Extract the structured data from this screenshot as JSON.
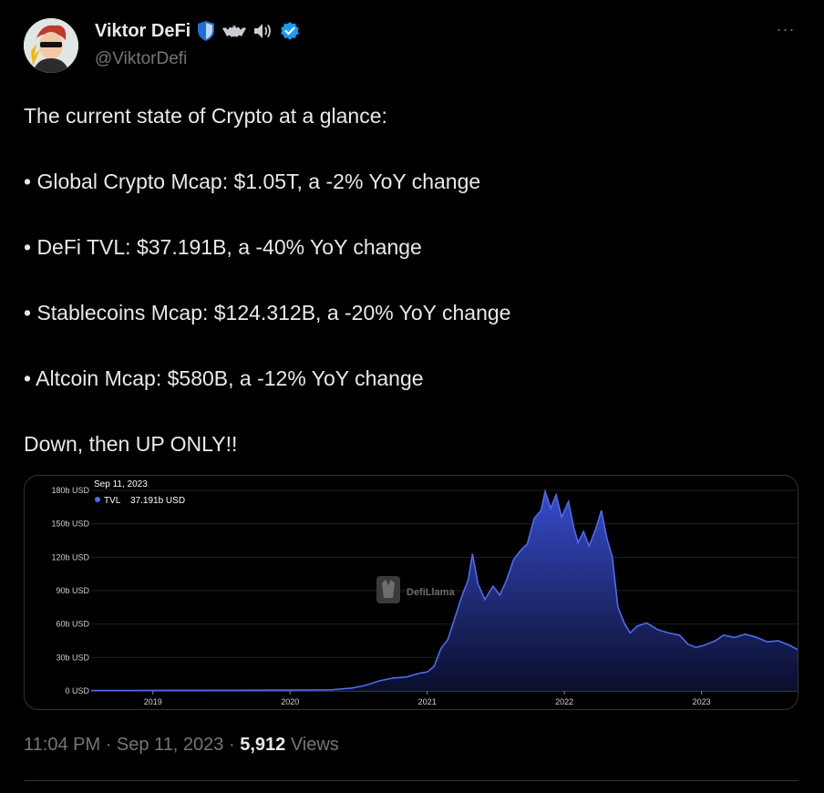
{
  "author": {
    "display_name": "Viktor DeFi",
    "handle": "@ViktorDefi",
    "badges": [
      "shield-icon",
      "bat-icon",
      "speaker-icon",
      "verified-icon"
    ],
    "verified_color": "#1d9bf0"
  },
  "tweet": {
    "intro": "The current state of Crypto at a glance:",
    "bullets": [
      "• Global Crypto Mcap: $1.05T, a -2% YoY change",
      "• DeFi TVL: $37.191B, a -40% YoY change",
      "• Stablecoins Mcap: $124.312B, a -20% YoY change",
      "• Altcoin Mcap: $580B, a -12% YoY change"
    ],
    "closing": "Down, then UP ONLY!!"
  },
  "chart_data": {
    "type": "area",
    "tooltip_date": "Sep 11, 2023",
    "tooltip_label": "TVL",
    "tooltip_value": "37.191b USD",
    "watermark": "DefiLlama",
    "yticks": [
      "0 USD",
      "30b USD",
      "60b USD",
      "90b USD",
      "120b USD",
      "150b USD",
      "180b USD"
    ],
    "xticks": [
      "2019",
      "2020",
      "2021",
      "2022",
      "2023"
    ],
    "ylim": [
      0,
      180
    ],
    "xlim": [
      2018.55,
      2023.7
    ],
    "line_color": "#4f6bed",
    "series": [
      {
        "values": [
          [
            2018.55,
            0.3
          ],
          [
            2019.0,
            0.5
          ],
          [
            2019.5,
            0.6
          ],
          [
            2020.0,
            0.7
          ],
          [
            2020.3,
            1.0
          ],
          [
            2020.45,
            2.5
          ],
          [
            2020.55,
            5.0
          ],
          [
            2020.65,
            9.0
          ],
          [
            2020.75,
            11.5
          ],
          [
            2020.85,
            12.5
          ],
          [
            2020.95,
            16.0
          ],
          [
            2021.0,
            17.0
          ],
          [
            2021.05,
            22.0
          ],
          [
            2021.1,
            38.0
          ],
          [
            2021.15,
            46.0
          ],
          [
            2021.2,
            65.0
          ],
          [
            2021.25,
            84.0
          ],
          [
            2021.3,
            100.0
          ],
          [
            2021.33,
            123.0
          ],
          [
            2021.37,
            96.0
          ],
          [
            2021.42,
            82.0
          ],
          [
            2021.48,
            94.0
          ],
          [
            2021.53,
            86.0
          ],
          [
            2021.58,
            100.0
          ],
          [
            2021.63,
            118.0
          ],
          [
            2021.68,
            126.0
          ],
          [
            2021.73,
            132.0
          ],
          [
            2021.78,
            155.0
          ],
          [
            2021.83,
            162.0
          ],
          [
            2021.86,
            179.0
          ],
          [
            2021.9,
            164.0
          ],
          [
            2021.94,
            176.0
          ],
          [
            2021.98,
            156.0
          ],
          [
            2022.03,
            170.0
          ],
          [
            2022.07,
            146.0
          ],
          [
            2022.1,
            133.0
          ],
          [
            2022.14,
            143.0
          ],
          [
            2022.18,
            130.0
          ],
          [
            2022.23,
            146.0
          ],
          [
            2022.27,
            162.0
          ],
          [
            2022.31,
            137.0
          ],
          [
            2022.35,
            120.0
          ],
          [
            2022.39,
            75.0
          ],
          [
            2022.44,
            60.0
          ],
          [
            2022.48,
            52.0
          ],
          [
            2022.53,
            58.0
          ],
          [
            2022.6,
            61.0
          ],
          [
            2022.68,
            55.0
          ],
          [
            2022.76,
            52.0
          ],
          [
            2022.84,
            50.0
          ],
          [
            2022.9,
            42.0
          ],
          [
            2022.96,
            39.0
          ],
          [
            2023.02,
            41.0
          ],
          [
            2023.1,
            45.0
          ],
          [
            2023.16,
            50.0
          ],
          [
            2023.24,
            48.0
          ],
          [
            2023.32,
            51.0
          ],
          [
            2023.4,
            48.0
          ],
          [
            2023.48,
            44.0
          ],
          [
            2023.56,
            45.0
          ],
          [
            2023.64,
            41.0
          ],
          [
            2023.7,
            37.2
          ]
        ]
      }
    ]
  },
  "timestamp": {
    "time": "11:04 PM",
    "separator": " · ",
    "date": "Sep 11, 2023",
    "separator2": " · ",
    "views_count": "5,912",
    "views_label": " Views"
  }
}
